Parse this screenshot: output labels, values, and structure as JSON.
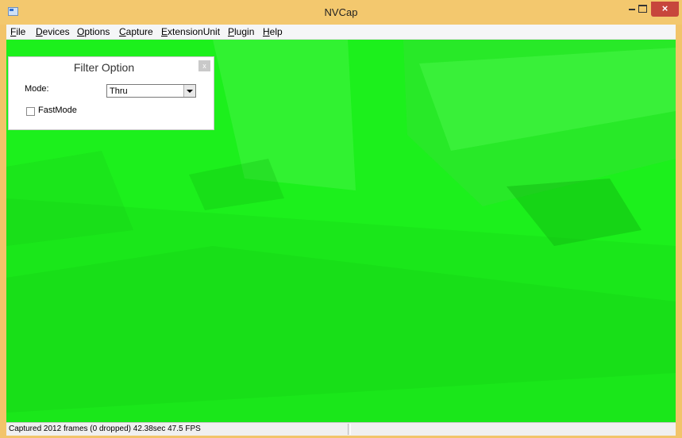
{
  "window": {
    "title": "NVCap",
    "controls": {
      "minimize_icon": "minimize-icon",
      "maximize_icon": "maximize-icon",
      "close_label": "×"
    }
  },
  "menu": {
    "items": [
      {
        "accel": "F",
        "rest": "ile"
      },
      {
        "accel": "D",
        "rest": "evices"
      },
      {
        "accel": "O",
        "rest": "ptions"
      },
      {
        "accel": "C",
        "rest": "apture"
      },
      {
        "accel": "E",
        "rest": "xtensionUnit"
      },
      {
        "accel": "P",
        "rest": "lugin"
      },
      {
        "accel": "H",
        "rest": "elp"
      }
    ]
  },
  "filter_option": {
    "title": "Filter Option",
    "close_label": "x",
    "mode_label": "Mode:",
    "mode_value": "Thru",
    "fastmode_label": "FastMode",
    "fastmode_checked": false
  },
  "status": {
    "text": "Captured 2012 frames (0 dropped) 42.38sec 47.5 FPS"
  },
  "colors": {
    "video_green": "#1cf01c",
    "titlebar": "#f3c86e",
    "close": "#c7463c"
  }
}
